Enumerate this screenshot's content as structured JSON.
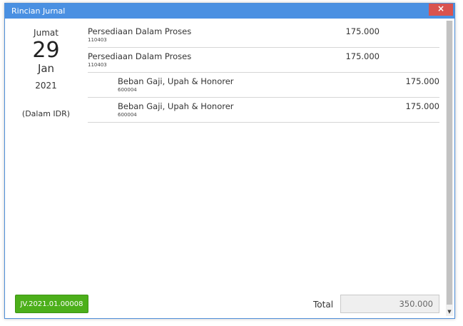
{
  "window": {
    "title": "Rincian Jurnal",
    "close_label": "×"
  },
  "date": {
    "weekday": "Jumat",
    "day": "29",
    "month": "Jan",
    "year": "2021",
    "currency": "(Dalam IDR)"
  },
  "entries": [
    {
      "side": "debit",
      "name": "Persediaan Dalam Proses",
      "code": "110403",
      "amount": "175.000"
    },
    {
      "side": "debit",
      "name": "Persediaan Dalam Proses",
      "code": "110403",
      "amount": "175.000"
    },
    {
      "side": "credit",
      "name": "Beban Gaji, Upah & Honorer",
      "code": "600004",
      "amount": "175.000"
    },
    {
      "side": "credit",
      "name": "Beban Gaji, Upah & Honorer",
      "code": "600004",
      "amount": "175.000"
    }
  ],
  "footer": {
    "journal_number": "JV.2021.01.00008",
    "total_label": "Total",
    "total_value": "350.000"
  },
  "scrollbar": {
    "down_arrow": "▼"
  },
  "colors": {
    "titlebar": "#4a90e2",
    "close": "#d9534f",
    "jv_button": "#4caf1a"
  }
}
